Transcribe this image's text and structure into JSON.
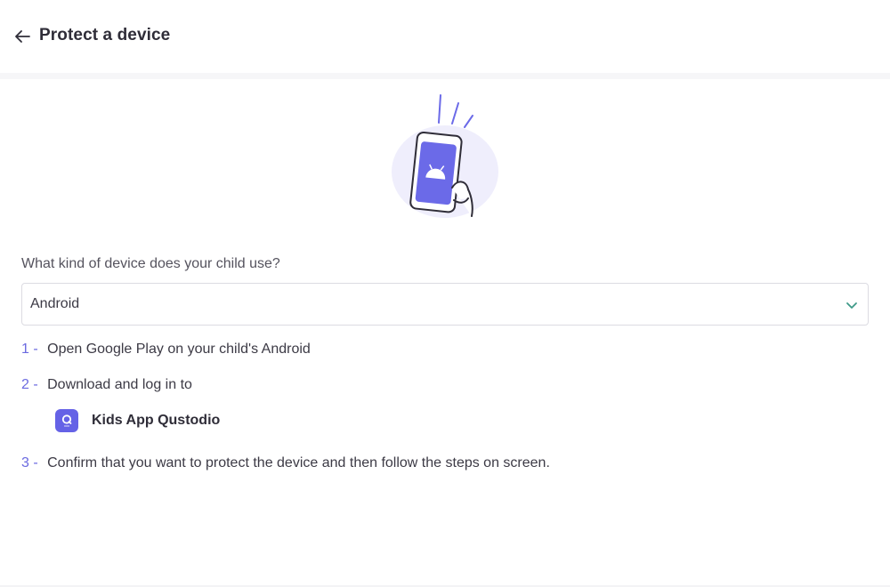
{
  "header": {
    "title": "Protect a device",
    "back_icon": "arrow-left-icon"
  },
  "illustration": {
    "icon": "android-phone-illustration",
    "colors": {
      "accent": "#6b6ae8",
      "blob": "#efeefc",
      "stroke": "#2f2d38"
    }
  },
  "form": {
    "question": "What kind of device does your child use?",
    "device_select": {
      "value": "Android",
      "chevron_icon": "chevron-down-icon",
      "chevron_color": "#3e9a88"
    }
  },
  "steps": [
    {
      "number": "1 -",
      "text": "Open Google Play on your child's Android"
    },
    {
      "number": "2 -",
      "text": "Download and log in to"
    },
    {
      "number": "3 -",
      "text": "Confirm that you want to protect the device and then follow the steps on screen."
    }
  ],
  "app": {
    "name": "Kids App Qustodio",
    "icon": "qustodio-kids-app-icon",
    "icon_color": "#6562e6"
  }
}
